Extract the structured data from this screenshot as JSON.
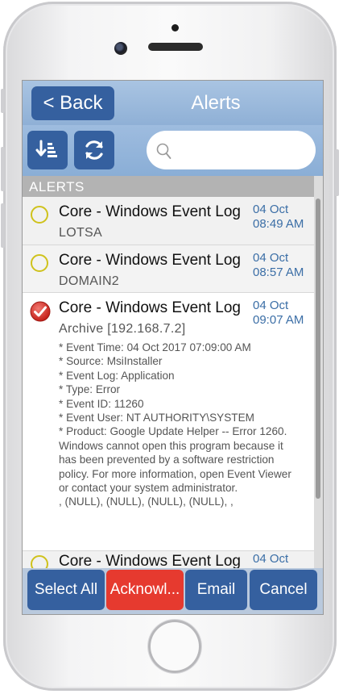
{
  "navbar": {
    "back_label": "< Back",
    "title": "Alerts"
  },
  "toolbar": {
    "sort_icon": "sort-down-icon",
    "refresh_icon": "refresh-icon",
    "search_placeholder": "",
    "search_value": ""
  },
  "list": {
    "section_header": "ALERTS",
    "items": [
      {
        "title": "Core - Windows Event Log",
        "subtitle": "LOTSA",
        "date": "04 Oct",
        "time": "08:49 AM",
        "selected": false
      },
      {
        "title": "Core - Windows Event Log",
        "subtitle": "DOMAIN2",
        "date": "04 Oct",
        "time": "08:57 AM",
        "selected": false
      },
      {
        "title": "Core - Windows Event Log",
        "subtitle": "Archive [192.168.7.2]",
        "date": "04 Oct",
        "time": "09:07 AM",
        "selected": true,
        "details": [
          "* Event Time: 04 Oct 2017 07:09:00 AM",
          "* Source: MsiInstaller",
          "* Event Log: Application",
          "* Type: Error",
          "* Event ID: 11260",
          "* Event User: NT AUTHORITY\\SYSTEM",
          "* Product: Google Update Helper -- Error 1260.",
          "Windows cannot open this program because it",
          "has been prevented by a software restriction",
          "policy. For more information, open Event Viewer",
          "or contact your system administrator.",
          ", (NULL), (NULL), (NULL), (NULL), ,"
        ]
      },
      {
        "title": "Core - Windows Event Log",
        "date": "04 Oct",
        "selected": false
      }
    ]
  },
  "bottombar": {
    "select_all": "Select All",
    "acknowledge": "Acknowl...",
    "email": "Email",
    "cancel": "Cancel"
  },
  "colors": {
    "accent_blue": "#35609f",
    "acknowledge_red": "#e63a2f",
    "date_blue": "#3b6ea6",
    "status_ring_yellow": "#cfc21c"
  }
}
